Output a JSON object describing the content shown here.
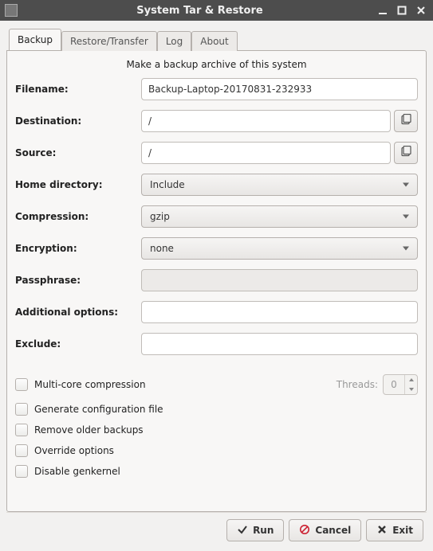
{
  "window": {
    "title": "System Tar & Restore"
  },
  "tabs": [
    {
      "label": "Backup",
      "active": true
    },
    {
      "label": "Restore/Transfer",
      "active": false
    },
    {
      "label": "Log",
      "active": false
    },
    {
      "label": "About",
      "active": false
    }
  ],
  "heading": "Make a backup archive of this system",
  "labels": {
    "filename": "Filename:",
    "destination": "Destination:",
    "source": "Source:",
    "home_directory": "Home directory:",
    "compression": "Compression:",
    "encryption": "Encryption:",
    "passphrase": "Passphrase:",
    "additional_options": "Additional options:",
    "exclude": "Exclude:",
    "threads": "Threads:"
  },
  "values": {
    "filename": "Backup-Laptop-20170831-232933",
    "destination": "/",
    "source": "/",
    "home_directory": "Include",
    "compression": "gzip",
    "encryption": "none",
    "passphrase": "",
    "additional_options": "",
    "exclude": "",
    "threads": "0"
  },
  "passphrase_enabled": false,
  "checks": {
    "multicore": {
      "label": "Multi-core compression",
      "checked": false
    },
    "genconf": {
      "label": "Generate configuration file",
      "checked": false
    },
    "remove_older": {
      "label": "Remove older backups",
      "checked": false
    },
    "override": {
      "label": "Override options",
      "checked": false
    },
    "disable_genkernel": {
      "label": "Disable genkernel",
      "checked": false
    }
  },
  "buttons": {
    "run": "Run",
    "cancel": "Cancel",
    "exit": "Exit"
  },
  "icons": {
    "browse": "browse-folder",
    "run": "checkmark",
    "cancel": "prohibit",
    "exit": "close-x"
  }
}
